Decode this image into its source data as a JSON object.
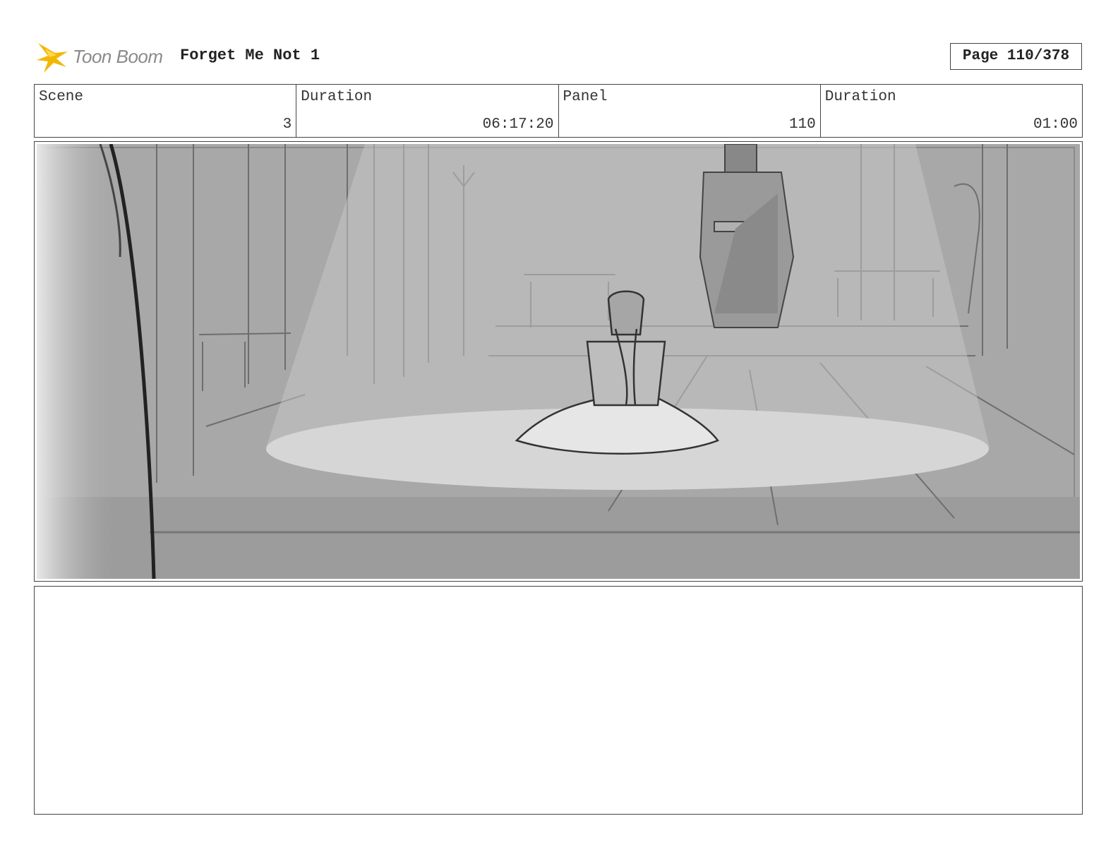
{
  "header": {
    "logo_text": "Toon Boom",
    "title": "Forget Me Not 1",
    "page": "Page 110/378"
  },
  "info": {
    "scene_label": "Scene",
    "scene_value": "3",
    "scene_duration_label": "Duration",
    "scene_duration_value": "06:17:20",
    "panel_label": "Panel",
    "panel_value": "110",
    "panel_duration_label": "Duration",
    "panel_duration_value": "01:00"
  },
  "notes": {
    "text": ""
  },
  "colors": {
    "logo_accent": "#f2b705",
    "border": "#444444",
    "sketch_bg": "#a8a8a8"
  }
}
